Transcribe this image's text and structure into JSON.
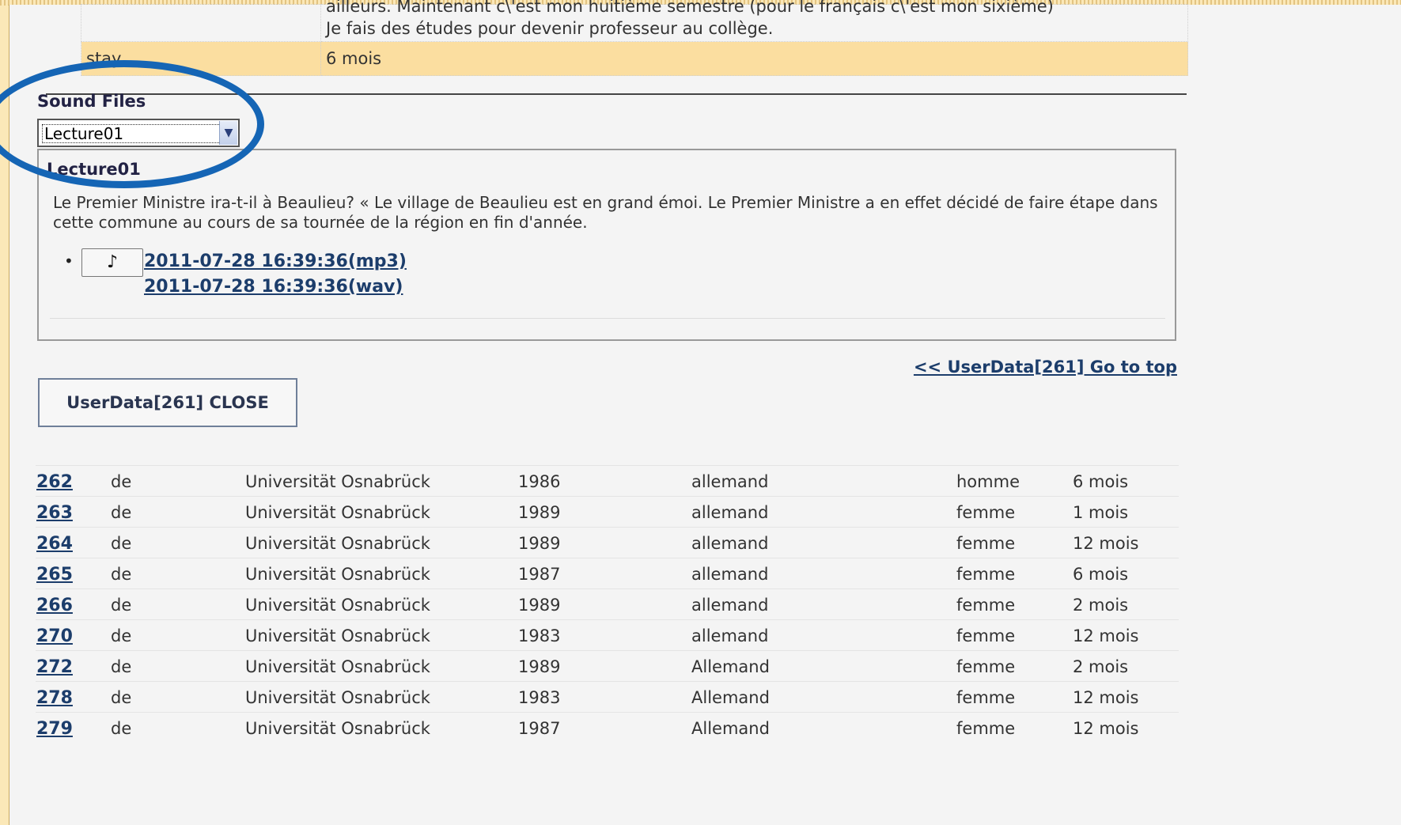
{
  "profile": {
    "description_line1": "ailleurs. Maintenant c\\'est mon huitième semestre (pour le français c\\'est mon sixième)",
    "description_line2": "Je fais des études pour devenir professeur au collège.",
    "stay_key": "stay",
    "stay_value": "6 mois"
  },
  "sound_files": {
    "heading": "Sound Files",
    "selected": "Lecture01",
    "panel_title": "Lecture01",
    "text": "Le Premier Ministre ira-t-il à Beaulieu? « Le village de Beaulieu est en grand émoi. Le Premier Ministre a en effet décidé de faire étape dans cette commune au cours de sa tournée de la région en fin d'année.",
    "play_icon": "♪",
    "link_mp3": "2011-07-28 16:39:36(mp3)",
    "link_wav": "2011-07-28 16:39:36(wav)"
  },
  "nav": {
    "go_to_top": "<< UserData[261] Go to top",
    "close_button": "UserData[261] CLOSE"
  },
  "users": [
    {
      "id": "262",
      "lang": "de",
      "university": "Universität Osnabrück",
      "year": "1986",
      "nationality": "allemand",
      "sex": "homme",
      "stay": "6 mois"
    },
    {
      "id": "263",
      "lang": "de",
      "university": "Universität Osnabrück",
      "year": "1989",
      "nationality": "allemand",
      "sex": "femme",
      "stay": "1 mois"
    },
    {
      "id": "264",
      "lang": "de",
      "university": "Universität Osnabrück",
      "year": "1989",
      "nationality": "allemand",
      "sex": "femme",
      "stay": "12 mois"
    },
    {
      "id": "265",
      "lang": "de",
      "university": "Universität Osnabrück",
      "year": "1987",
      "nationality": "allemand",
      "sex": "femme",
      "stay": "6 mois"
    },
    {
      "id": "266",
      "lang": "de",
      "university": "Universität Osnabrück",
      "year": "1989",
      "nationality": "allemand",
      "sex": "femme",
      "stay": "2 mois"
    },
    {
      "id": "270",
      "lang": "de",
      "university": "Universität Osnabrück",
      "year": "1983",
      "nationality": "allemand",
      "sex": "femme",
      "stay": "12 mois"
    },
    {
      "id": "272",
      "lang": "de",
      "university": "Universität Osnabrück",
      "year": "1989",
      "nationality": "Allemand",
      "sex": "femme",
      "stay": "2 mois"
    },
    {
      "id": "278",
      "lang": "de",
      "university": "Universität Osnabrück",
      "year": "1983",
      "nationality": "Allemand",
      "sex": "femme",
      "stay": "12 mois"
    },
    {
      "id": "279",
      "lang": "de",
      "university": "Universität Osnabrück",
      "year": "1987",
      "nationality": "Allemand",
      "sex": "femme",
      "stay": "12 mois"
    }
  ],
  "colors": {
    "annotation_ellipse": "#1565b5",
    "page_border": "#fbe8b8",
    "stay_row": "#fbdea0",
    "link": "#1c3d6b"
  }
}
